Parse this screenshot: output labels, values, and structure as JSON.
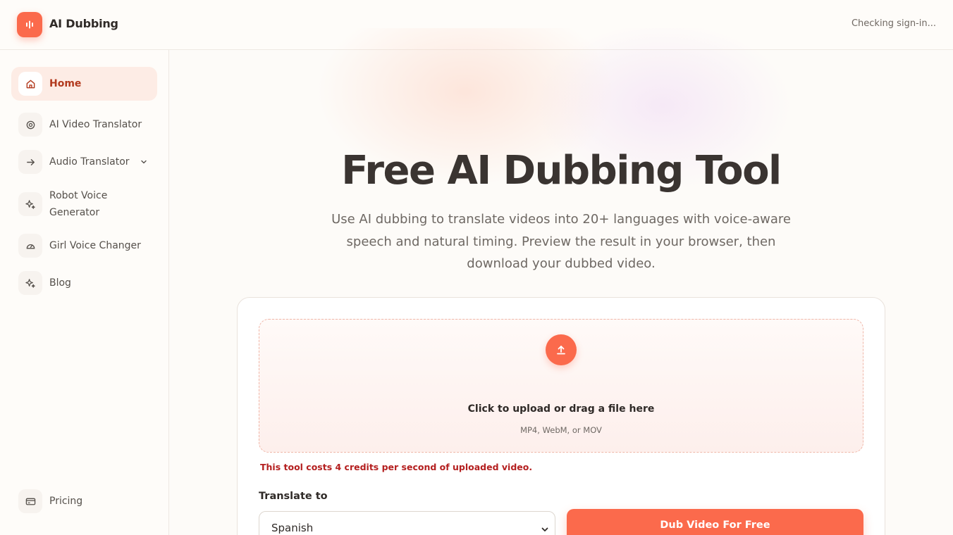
{
  "app": {
    "name": "AI Dubbing",
    "signin_status": "Checking sign-in..."
  },
  "sidebar": {
    "items": [
      {
        "label": "Home",
        "icon": "home-icon",
        "active": true
      },
      {
        "label": "AI Video Translator",
        "icon": "target-icon"
      },
      {
        "label": "Audio Translator",
        "icon": "arrow-right-icon",
        "has_submenu": true
      },
      {
        "label_line1": "Robot Voice",
        "label_line2": "Generator",
        "icon": "sparkles-icon"
      },
      {
        "label": "Girl Voice Changer",
        "icon": "gauge-icon"
      },
      {
        "label": "Blog",
        "icon": "sparkles-icon"
      }
    ],
    "footer_item": {
      "label": "Pricing",
      "icon": "credit-card-icon"
    }
  },
  "hero": {
    "title": "Free AI Dubbing Tool",
    "description": "Use AI dubbing to translate videos into 20+ languages with voice-aware speech and natural timing. Preview the result in your browser, then download your dubbed video."
  },
  "upload": {
    "title": "Click to upload or drag a file here",
    "formats": "MP4, WebM, or MOV",
    "credit_note": "This tool costs 4 credits per second of uploaded video."
  },
  "form": {
    "translate_label": "Translate to",
    "selected_language": "Spanish",
    "submit_label": "Dub Video For Free"
  },
  "colors": {
    "accent": "#fb6a4c",
    "active_bg": "#fdece5",
    "warning": "#b41f1f"
  }
}
